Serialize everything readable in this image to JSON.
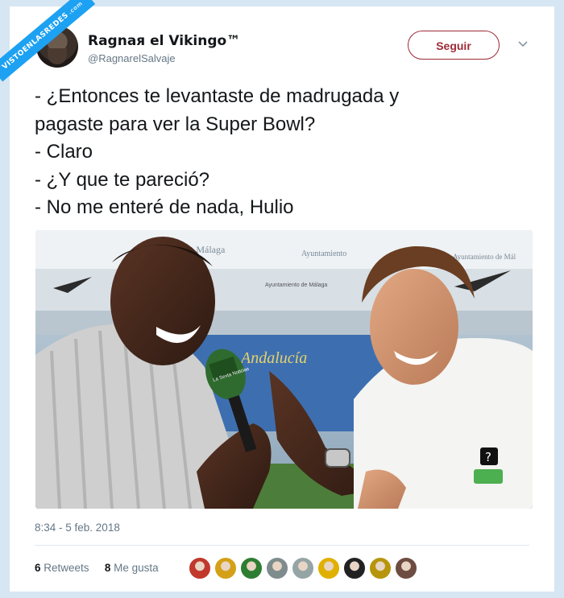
{
  "watermark": {
    "text": "VISTOENLASREDES",
    "sub": ".com"
  },
  "user": {
    "display_name": "Ragnaя el Vikingo™",
    "handle": "@RagnarelSalvaje"
  },
  "follow_label": "Seguir",
  "tweet_lines": [
    "- ¿Entonces te levantaste de madrugada y",
    "pagaste para ver la Super Bowl?",
    "- Claro",
    "- ¿Y que te pareció?",
    "- No me enteré de nada, Hulio"
  ],
  "media": {
    "banner_texts": [
      "de Málaga",
      "Ayuntamiento",
      "Ayuntamiento de Mál",
      "Andalucía",
      "Ayuntamiento de Málaga"
    ],
    "mic_label": "La Sexta Noticias"
  },
  "timestamp": "8:34 - 5 feb. 2018",
  "stats": {
    "retweets_count": "6",
    "retweets_label": "Retweets",
    "likes_count": "8",
    "likes_label": "Me gusta"
  },
  "liker_colors": [
    "#c0392b",
    "#d4a017",
    "#2e7d32",
    "#7f8c8d",
    "#95a5a6",
    "#e0b000",
    "#222222",
    "#b7950b",
    "#6d4c41"
  ]
}
